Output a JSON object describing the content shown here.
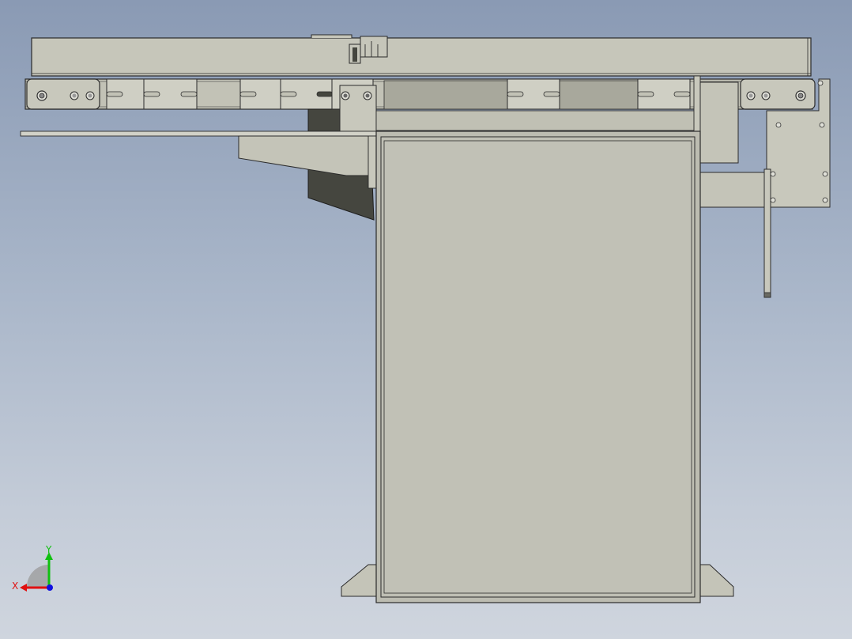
{
  "triad": {
    "x_label": "X",
    "y_label": "Y",
    "x_color": "#e01010",
    "y_color": "#10c010",
    "origin_color": "#1010e0"
  },
  "colors": {
    "background_top": "#8a9ab4",
    "background_bottom": "#cfd5de",
    "part_fill": "#c4c4b8",
    "panel_fill": "#bdbdb2",
    "dark_fill": "#45463f",
    "outline": "#2b2b2b"
  }
}
